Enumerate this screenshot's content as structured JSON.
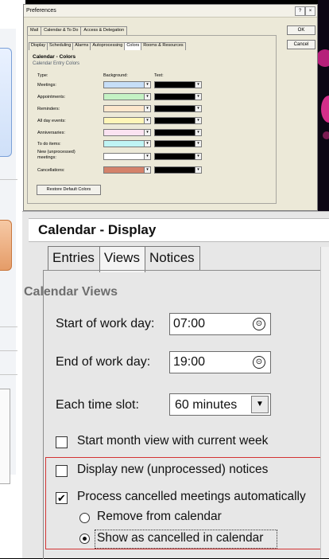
{
  "preferences_dialog": {
    "title": "Preferences",
    "help_button": "?",
    "close_button": "×",
    "outer_tabs": [
      "Mail",
      "Calendar & To Do",
      "Access & Delegation"
    ],
    "ok_label": "OK",
    "cancel_label": "Cancel",
    "inner_tabs": [
      "Display",
      "Scheduling",
      "Alarms",
      "Autoprocessing",
      "Colors",
      "Rooms & Resources"
    ],
    "active_inner_tab": "Colors",
    "section_title": "Calendar - Colors",
    "subsection_title": "Calendar Entry Colors",
    "col_type": "Type:",
    "col_background": "Background:",
    "col_text": "Text:",
    "color_rows": [
      {
        "label": "Meetings:",
        "bg": "#c6def7",
        "text": "#000000"
      },
      {
        "label": "Appointments:",
        "bg": "#c4f2c4",
        "text": "#000000"
      },
      {
        "label": "Reminders:",
        "bg": "#fde7cc",
        "text": "#000000"
      },
      {
        "label": "All day events:",
        "bg": "#fff6b8",
        "text": "#000000"
      },
      {
        "label": "Anniversaries:",
        "bg": "#fbe3f2",
        "text": "#000000"
      },
      {
        "label": "To do items:",
        "bg": "#bff4f4",
        "text": "#000000"
      },
      {
        "label": "New (unprocessed) meetings:",
        "bg": "#ffffff",
        "text": "#000000"
      },
      {
        "label": "Cancellations:",
        "bg": "#d4826a",
        "text": "#000000"
      }
    ],
    "restore_button": "Restore Default Colors"
  },
  "calendar_display": {
    "title": "Calendar - Display",
    "tabs": [
      "Entries",
      "Views",
      "Notices"
    ],
    "active_tab": "Views",
    "section_label": "Calendar Views",
    "start_label": "Start of work day:",
    "start_value": "07:00",
    "end_label": "End of work day:",
    "end_value": "19:00",
    "slot_label": "Each time slot:",
    "slot_value": "60 minutes",
    "checkboxes": [
      {
        "label": "Start month view with current week",
        "checked": false
      },
      {
        "label": "Display new (unprocessed) notices",
        "checked": false
      },
      {
        "label": "Process cancelled meetings automatically",
        "checked": true
      }
    ],
    "radios": [
      {
        "label": "Remove from calendar",
        "selected": false
      },
      {
        "label": "Show as cancelled in calendar",
        "selected": true
      }
    ],
    "highlight_color": "#d33333"
  }
}
